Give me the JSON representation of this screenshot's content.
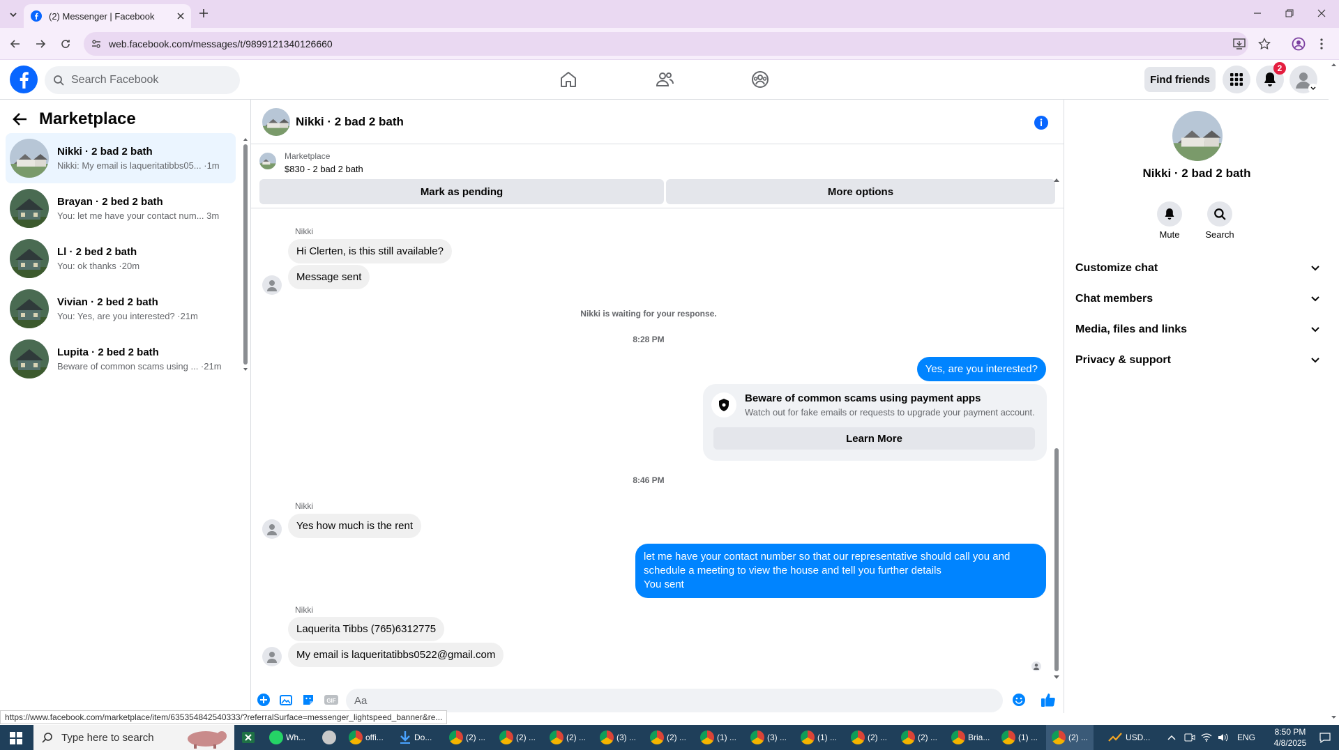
{
  "browser": {
    "tab_title": "(2) Messenger | Facebook",
    "url": "web.facebook.com/messages/t/9899121340126660",
    "status_url": "https://www.facebook.com/marketplace/item/635354842540333/?referralSurface=messenger_lightspeed_banner&re..."
  },
  "header": {
    "search_placeholder": "Search Facebook",
    "find_friends": "Find friends",
    "notification_count": "2"
  },
  "left": {
    "title": "Marketplace",
    "conversations": [
      {
        "name": "Nikki · 2 bad 2 bath",
        "preview": "Nikki: My email is laqueritatibbs05... ·1m"
      },
      {
        "name": "Brayan · 2 bed 2 bath",
        "preview": "You: let me have your contact num... 3m"
      },
      {
        "name": "Ll · 2 bed 2 bath",
        "preview": "You: ok thanks ·20m"
      },
      {
        "name": "Vivian · 2 bed 2 bath",
        "preview": "You: Yes, are you interested? ·21m"
      },
      {
        "name": "Lupita · 2 bed 2 bath",
        "preview": "Beware of common scams using ... ·21m"
      }
    ]
  },
  "chat": {
    "title": "Nikki · 2 bad 2 bath",
    "listing_source": "Marketplace",
    "listing_price": "$830 - 2 bad 2 bath",
    "mark_pending": "Mark as pending",
    "more_options": "More options",
    "sender": "Nikki",
    "msg1": "Hi Clerten, is this still available?",
    "msg2": "Message sent",
    "waiting": "Nikki is waiting for your response.",
    "time1": "8:28 PM",
    "out1": "Yes, are you interested?",
    "scam_title": "Beware of common scams using payment apps",
    "scam_body": "Watch out for fake emails or requests to upgrade your payment account.",
    "learn_more": "Learn More",
    "time2": "8:46 PM",
    "msg3": "Yes how much is the rent",
    "out2_line1": "let me have your contact number so that our representative should call you and",
    "out2_line2": "schedule a meeting to view the house and tell you further details",
    "out2_line3": "You sent",
    "msg4": "Laquerita Tibbs (765)6312775",
    "msg5": "My email is laqueritatibbs0522@gmail.com",
    "composer_placeholder": "Aa"
  },
  "right": {
    "name": "Nikki · 2 bad 2 bath",
    "mute": "Mute",
    "search": "Search",
    "rows": [
      "Customize chat",
      "Chat members",
      "Media, files and links",
      "Privacy & support"
    ]
  },
  "taskbar": {
    "search_placeholder": "Type here to search",
    "items": [
      "Wh...",
      "offi...",
      "Do...",
      "(2) ...",
      "(2) ...",
      "(2) ...",
      "(3) ...",
      "(2) ...",
      "(1) ...",
      "(3) ...",
      "(1) ...",
      "(2) ...",
      "(2) ...",
      "Bria...",
      "(1) ...",
      "(2) ..."
    ],
    "currency": "USD...",
    "lang": "ENG",
    "time": "8:50 PM",
    "date": "4/8/2025"
  },
  "colors": {
    "messenger_blue": "#0084ff",
    "fb_blue": "#0866ff",
    "tab_bg": "#ead9f2"
  }
}
